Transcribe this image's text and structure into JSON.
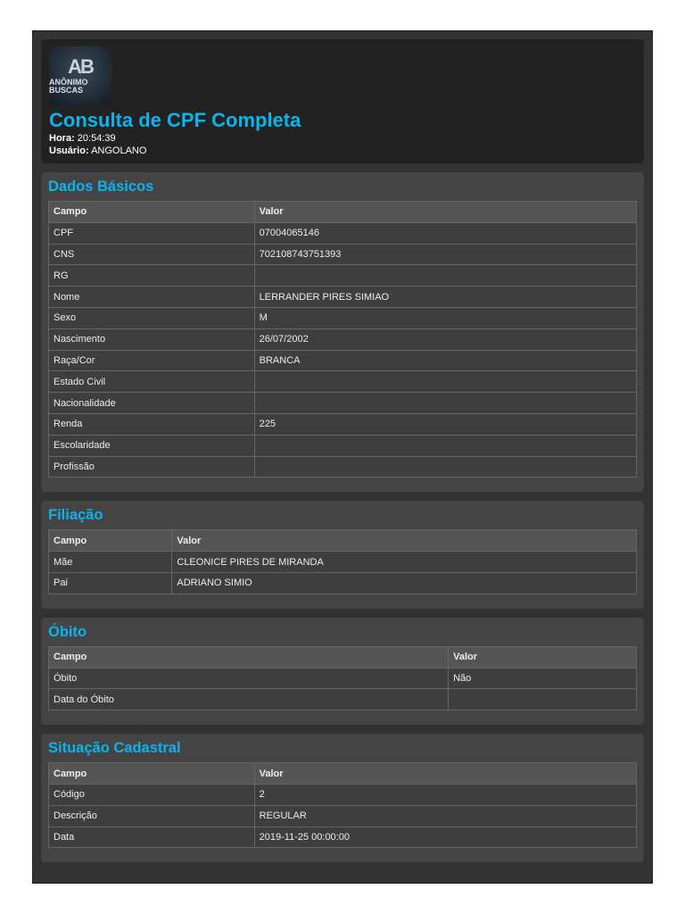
{
  "header": {
    "logo_text": "ANÔNIMO BUSCAS",
    "logo_mark": "AB",
    "title": "Consulta de CPF Completa",
    "hora_label": "Hora:",
    "hora": "20:54:39",
    "usuario_label": "Usuário:",
    "usuario": "ANGOLANO"
  },
  "sections": [
    {
      "title": "Dados Básicos",
      "headers": [
        "Campo",
        "Valor"
      ],
      "rows": [
        [
          "CPF",
          "07004065146"
        ],
        [
          "CNS",
          "702108743751393"
        ],
        [
          "RG",
          ""
        ],
        [
          "Nome",
          "LERRANDER PIRES SIMIAO"
        ],
        [
          "Sexo",
          "M"
        ],
        [
          "Nascimento",
          "26/07/2002"
        ],
        [
          "Raça/Cor",
          "BRANCA"
        ],
        [
          "Estado Civil",
          ""
        ],
        [
          "Nacionalidade",
          ""
        ],
        [
          "Renda",
          "225"
        ],
        [
          "Escolaridade",
          ""
        ],
        [
          "Profissão",
          ""
        ]
      ]
    },
    {
      "title": "Filiação",
      "headers": [
        "Campo",
        "Valor"
      ],
      "rows": [
        [
          "Mãe",
          "CLEONICE PIRES DE MIRANDA"
        ],
        [
          "Pai",
          "ADRIANO SIMIO"
        ]
      ]
    },
    {
      "title": "Óbito",
      "headers": [
        "Campo",
        "Valor"
      ],
      "rows": [
        [
          "Óbito",
          "Não"
        ],
        [
          "Data do Óbito",
          ""
        ]
      ]
    },
    {
      "title": "Situação Cadastral",
      "headers": [
        "Campo",
        "Valor"
      ],
      "rows": [
        [
          "Código",
          "2"
        ],
        [
          "Descrição",
          "REGULAR"
        ],
        [
          "Data",
          "2019-11-25 00:00:00"
        ]
      ]
    }
  ]
}
